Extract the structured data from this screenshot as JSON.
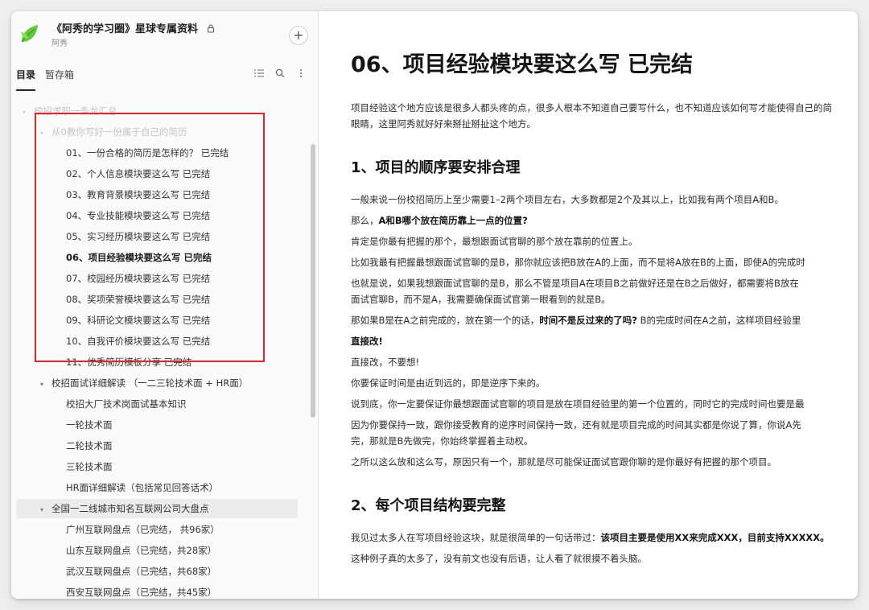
{
  "sidebar": {
    "group_title": "《阿秀的学习圈》星球专属资料",
    "group_subtitle": "阿秀",
    "add_label": "+",
    "tabs": [
      "目录",
      "暂存箱"
    ],
    "tree": [
      {
        "label": "校招求职一条龙汇总",
        "level": 0,
        "caret": "▾",
        "style": "faded"
      },
      {
        "label": "从0教你写好一份属于自己的简历",
        "level": 1,
        "caret": "▾",
        "style": "faded"
      },
      {
        "label": "01、一份合格的简历是怎样的？ 已完结",
        "level": 2
      },
      {
        "label": "02、个人信息模块要这么写 已完结",
        "level": 2
      },
      {
        "label": "03、教育背景模块要这么写 已完结",
        "level": 2
      },
      {
        "label": "04、专业技能模块要这么写 已完结",
        "level": 2
      },
      {
        "label": "05、实习经历模块要这么写 已完结",
        "level": 2
      },
      {
        "label": "06、项目经验模块要这么写 已完结",
        "level": 2,
        "style": "bold"
      },
      {
        "label": "07、校园经历模块要这么写 已完结",
        "level": 2
      },
      {
        "label": "08、奖项荣誉模块要这么写 已完结",
        "level": 2
      },
      {
        "label": "09、科研论文模块要这么写 已完结",
        "level": 2
      },
      {
        "label": "10、自我评价模块要这么写 已完结",
        "level": 2
      },
      {
        "label": "11、优秀简历模板分享 已完结",
        "level": 2
      },
      {
        "label": "校招面试详细解读 （一二三轮技术面 + HR面）",
        "level": 1,
        "caret": "▾"
      },
      {
        "label": "校招大厂技术岗面试基本知识",
        "level": 2
      },
      {
        "label": "一轮技术面",
        "level": 2
      },
      {
        "label": "二轮技术面",
        "level": 2
      },
      {
        "label": "三轮技术面",
        "level": 2
      },
      {
        "label": "HR面详细解读（包括常见回答话术）",
        "level": 2
      },
      {
        "label": "全国一二线城市知名互联网公司大盘点",
        "level": 1,
        "caret": "▾",
        "style": "hl"
      },
      {
        "label": "广州互联网盘点（已完结， 共96家）",
        "level": 2
      },
      {
        "label": "山东互联网盘点（已完结，共28家）",
        "level": 2
      },
      {
        "label": "武汉互联网盘点（已完结，共68家）",
        "level": 2
      },
      {
        "label": "西安互联网盘点（已完结，共45家）",
        "level": 2
      }
    ]
  },
  "doc": {
    "title": "06、项目经验模块要这么写 已完结",
    "blocks": [
      {
        "type": "p",
        "segments": [
          {
            "t": "项目经验这个地方应该是很多人都头疼的点，很多人根本不知道自己要写什么，也不知道应该如何写才能使得自己的简"
          }
        ]
      },
      {
        "type": "p",
        "segments": [
          {
            "t": "眼睛，这里阿秀就好好来掰扯掰扯这个地方。"
          }
        ]
      },
      {
        "type": "h2",
        "text": "1、项目的顺序要安排合理"
      },
      {
        "type": "p",
        "segments": [
          {
            "t": "一般来说一份校招简历上至少需要1–2两个项目左右，大多数都是2个及其以上，比如我有两个项目A和B。"
          }
        ]
      },
      {
        "type": "p",
        "segments": [
          {
            "t": "那么，"
          },
          {
            "t": "A和B哪个放在简历靠上一点的位置?",
            "b": true
          }
        ]
      },
      {
        "type": "p",
        "segments": [
          {
            "t": "肯定是你最有把握的那个，最想跟面试官聊的那个放在靠前的位置上。"
          }
        ]
      },
      {
        "type": "p",
        "segments": [
          {
            "t": "比如我最有把握最想跟面试官聊的是B，那你就应该把B放在A的上面，而不是将A放在B的上面，即使A的完成时"
          }
        ]
      },
      {
        "type": "p",
        "segments": [
          {
            "t": "也就是说，如果我想跟面试官聊的是B，那么不管是项目A在项目B之前做好还是在B之后做好，都需要将B放在"
          }
        ]
      },
      {
        "type": "p",
        "segments": [
          {
            "t": "面试官聊B，而不是A，我需要确保面试官第一眼看到的就是B。"
          }
        ]
      },
      {
        "type": "p",
        "segments": [
          {
            "t": "那如果B是在A之前完成的，放在第一个的话，"
          },
          {
            "t": "时间不是反过来的了吗?",
            "b": true
          },
          {
            "t": " B的完成时间在A之前，这样项目经验里"
          }
        ]
      },
      {
        "type": "p",
        "segments": [
          {
            "t": "直接改!",
            "b": true
          }
        ]
      },
      {
        "type": "p",
        "segments": [
          {
            "t": "直接改，不要想!"
          }
        ]
      },
      {
        "type": "p",
        "segments": [
          {
            "t": "你要保证时间是由近到远的，即是逆序下来的。"
          }
        ]
      },
      {
        "type": "p",
        "segments": [
          {
            "t": "说到底，你一定要保证你最想跟面试官聊的项目是放在项目经验里的第一个位置的，同时它的完成时间也要是最"
          }
        ]
      },
      {
        "type": "p",
        "segments": [
          {
            "t": "因为你要保持一致，跟你接受教育的逆序时间保持一致，还有就是项目完成的时间其实都是你说了算，你说A先"
          }
        ]
      },
      {
        "type": "p",
        "segments": [
          {
            "t": "完，那就是B先做完，你始终掌握着主动权。"
          }
        ]
      },
      {
        "type": "p",
        "segments": [
          {
            "t": "之所以这么放和这么写，原因只有一个，那就是尽可能保证面试官跟你聊的是你最好有把握的那个项目。"
          }
        ]
      },
      {
        "type": "h2",
        "text": "2、每个项目结构要完整"
      },
      {
        "type": "p",
        "segments": [
          {
            "t": "我见过太多人在写项目经验这块，就是很简单的一句话带过："
          },
          {
            "t": "该项目主要是使用XX来完成XXX，目前支持XXXXX。",
            "b": true
          }
        ]
      },
      {
        "type": "p",
        "segments": [
          {
            "t": "这种例子真的太多了，没有前文也没有后语，让人看了就很摸不着头脑。"
          }
        ]
      }
    ]
  },
  "colors": {
    "highlight_box": "#e0262a",
    "logo": "#5fc93a"
  },
  "icons": [
    "logo-icon",
    "lock-icon",
    "plus-icon",
    "list-icon",
    "search-icon",
    "more-icon",
    "caret-down-icon"
  ]
}
